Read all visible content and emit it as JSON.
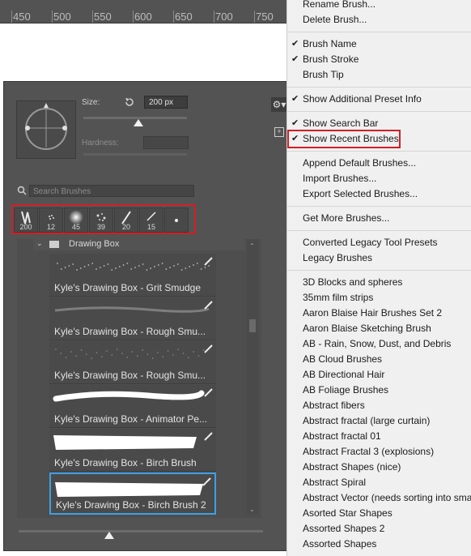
{
  "ruler": {
    "labels": [
      "450",
      "500",
      "550",
      "600",
      "650",
      "700",
      "750"
    ]
  },
  "panel": {
    "size_label": "Size:",
    "size_value": "200 px",
    "size_slider_percent": 53,
    "hardness_label": "Hardness:",
    "search_placeholder": "Search Brushes",
    "recent_brushes": [
      "200",
      "12",
      "45",
      "39",
      "20",
      "15",
      ""
    ],
    "group_name": "Drawing Box",
    "brushes": [
      {
        "name": "Kyle's Drawing Box - Grit Smudge",
        "tool": "smudge-icon"
      },
      {
        "name": "Kyle's Drawing Box - Rough Smu...",
        "tool": "smudge-icon"
      },
      {
        "name": "Kyle's Drawing Box - Rough Smu...",
        "tool": "smudge-icon"
      },
      {
        "name": "Kyle's Drawing Box - Animator Pe...",
        "tool": "brush-icon"
      },
      {
        "name": "Kyle's Drawing Box - Birch Brush",
        "tool": "brush-icon"
      },
      {
        "name": "Kyle's Drawing Box - Birch Brush 2",
        "tool": "brush-icon"
      }
    ],
    "preview_slider_percent": 37
  },
  "menu": {
    "items": [
      {
        "label": "Rename Brush...",
        "checked": false
      },
      {
        "label": "Delete Brush...",
        "checked": false
      },
      {
        "label": "---"
      },
      {
        "label": "Brush Name",
        "checked": true
      },
      {
        "label": "Brush Stroke",
        "checked": true
      },
      {
        "label": "Brush Tip",
        "checked": false
      },
      {
        "label": "---"
      },
      {
        "label": "Show Additional Preset Info",
        "checked": true
      },
      {
        "label": "---"
      },
      {
        "label": "Show Search Bar",
        "checked": true
      },
      {
        "label": "Show Recent Brushes",
        "checked": true
      },
      {
        "label": "---"
      },
      {
        "label": "Append Default Brushes...",
        "checked": false
      },
      {
        "label": "Import Brushes...",
        "checked": false
      },
      {
        "label": "Export Selected Brushes...",
        "checked": false
      },
      {
        "label": "---"
      },
      {
        "label": "Get More Brushes...",
        "checked": false
      },
      {
        "label": "---"
      },
      {
        "label": "Converted Legacy Tool Presets",
        "checked": false
      },
      {
        "label": "Legacy Brushes",
        "checked": false
      },
      {
        "label": "---"
      },
      {
        "label": "3D Blocks and spheres",
        "checked": false
      },
      {
        "label": "35mm film strips",
        "checked": false
      },
      {
        "label": "Aaron Blaise Hair Brushes Set 2",
        "checked": false
      },
      {
        "label": "Aaron Blaise Sketching Brush",
        "checked": false
      },
      {
        "label": "AB - Rain, Snow, Dust, and Debris",
        "checked": false
      },
      {
        "label": "AB Cloud Brushes",
        "checked": false
      },
      {
        "label": "AB Directional Hair",
        "checked": false
      },
      {
        "label": "AB Foliage Brushes",
        "checked": false
      },
      {
        "label": "Abstract fibers",
        "checked": false
      },
      {
        "label": "Abstract fractal (large curtain)",
        "checked": false
      },
      {
        "label": "Abstract fractal 01",
        "checked": false
      },
      {
        "label": "Abstract Fractal 3 (explosions)",
        "checked": false
      },
      {
        "label": "Abstract Shapes (nice)",
        "checked": false
      },
      {
        "label": "Abstract Spiral",
        "checked": false
      },
      {
        "label": "Abstract Vector (needs sorting into sma",
        "checked": false
      },
      {
        "label": "Asorted Star Shapes",
        "checked": false
      },
      {
        "label": "Assorted Shapes 2",
        "checked": false
      },
      {
        "label": "Assorted Shapes",
        "checked": false
      }
    ]
  },
  "colors": {
    "highlight": "#d11f26",
    "selection": "#3ea0e6"
  }
}
